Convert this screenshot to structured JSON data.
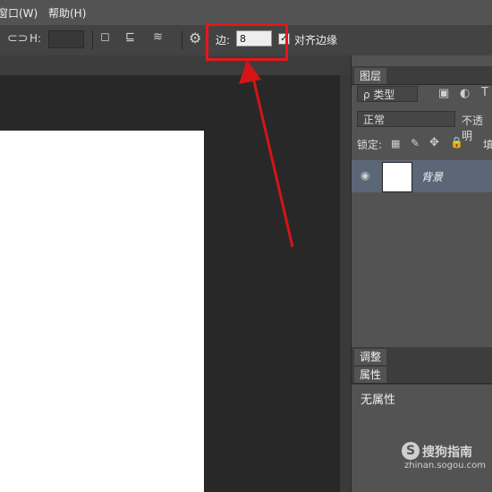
{
  "menubar": {
    "window": "窗口(W)",
    "help": "帮助(H)"
  },
  "options": {
    "h_label": "H:",
    "sides_label": "边:",
    "sides_value": "8",
    "align_edges_checked": "✓",
    "align_edges_label": "对齐边缘"
  },
  "layers_panel": {
    "tab": "图层",
    "kind_filter": "ρ 类型",
    "blend_mode": "正常",
    "opacity_label": "不透明",
    "lock_label": "锁定:",
    "fill_label": "填",
    "layer_name": "背景"
  },
  "adjust_tab": "调整",
  "props_tab": "属性",
  "props_text": "无属性",
  "watermark": {
    "logo": "S",
    "brand": "搜狗指南",
    "url": "zhinan.sogou.com"
  },
  "colors": {
    "highlight": "#e8161a",
    "arrow": "#d41417"
  }
}
